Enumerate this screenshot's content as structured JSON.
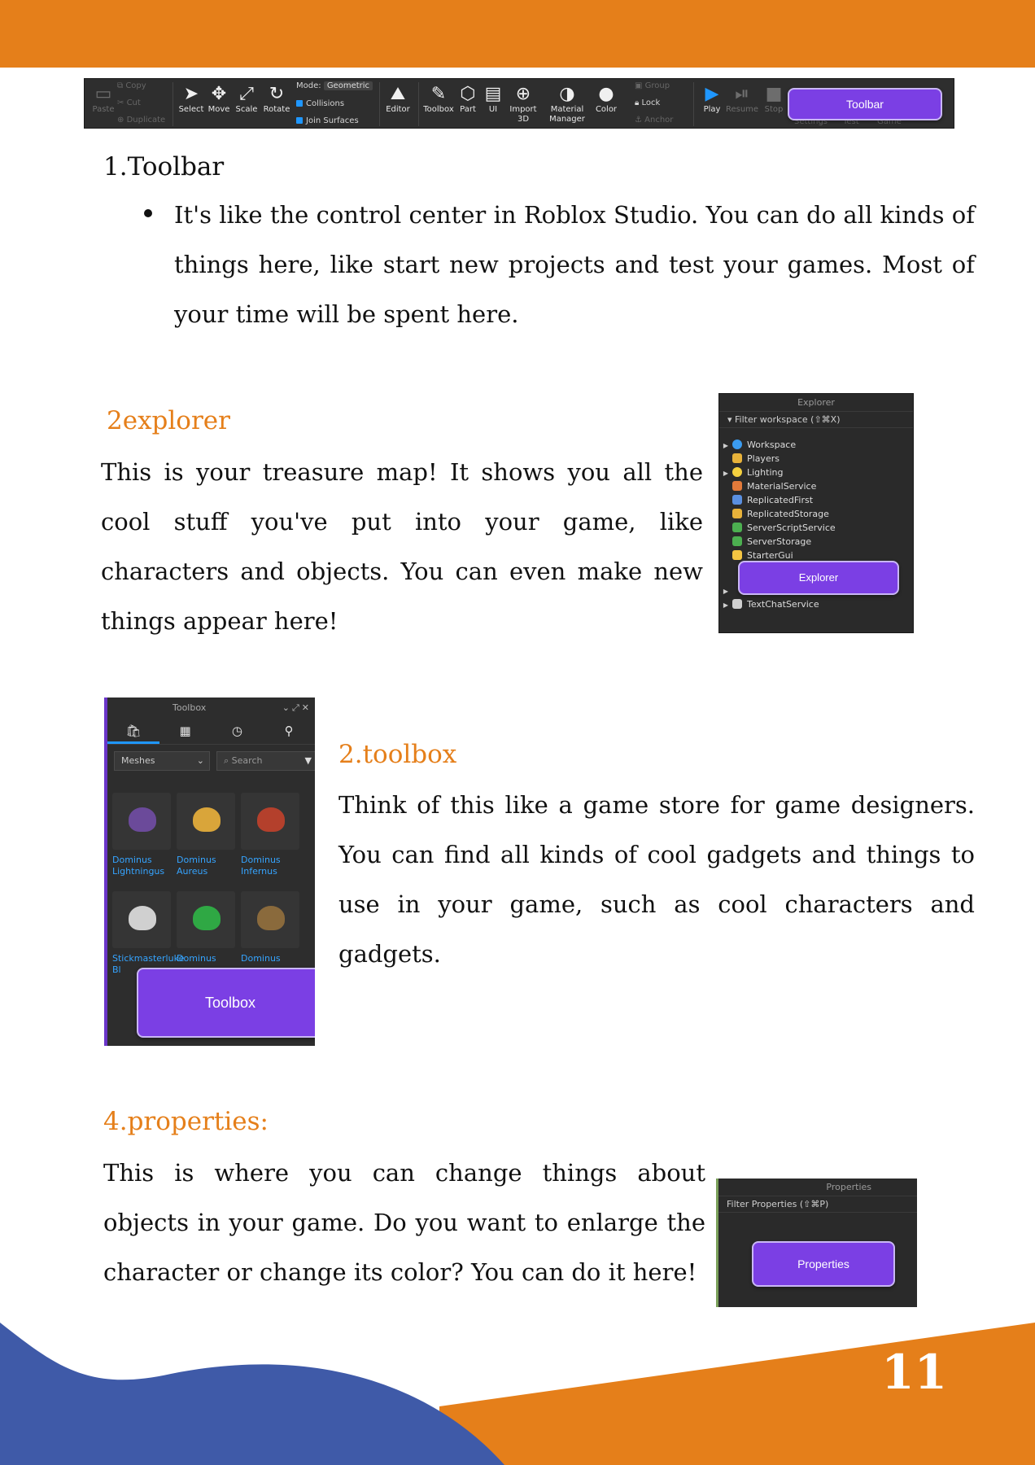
{
  "toolbar_shot": {
    "clipboard": [
      "Paste",
      "Copy",
      "Cut",
      "Duplicate"
    ],
    "tools": [
      "Select",
      "Move",
      "Scale",
      "Rotate"
    ],
    "mode_label": "Mode:",
    "mode_value": "Geometric",
    "collisions": "Collisions",
    "join_surfaces": "Join Surfaces",
    "editor": "Editor",
    "insert": [
      "Toolbox",
      "Part",
      "UI",
      "Import 3D"
    ],
    "material_manager": "Material Manager",
    "color": "Color",
    "group": "Group",
    "lock": "Lock",
    "anchor": "Anchor",
    "play": [
      "Play",
      "Resume",
      "Stop"
    ],
    "right_tabs": [
      "Settings",
      "Test",
      "Game"
    ],
    "callout": "Toolbar"
  },
  "section1": {
    "heading": "1.Toolbar",
    "bullet": "It's like the control center in Roblox Studio. You can do all kinds of things here, like start new projects and test your games. Most of your time will be spent here."
  },
  "section2": {
    "heading": "2explorer",
    "body": "This is your treasure map! It shows you all the cool stuff you've put into your game, like characters and objects. You can even make new things appear here!"
  },
  "explorer_shot": {
    "title": "Explorer",
    "filter": "Filter workspace (⇧⌘X)",
    "items": [
      "Workspace",
      "Players",
      "Lighting",
      "MaterialService",
      "ReplicatedFirst",
      "ReplicatedStorage",
      "ServerScriptService",
      "ServerStorage",
      "StarterGui",
      "TextChatService"
    ],
    "icon_colors": [
      "#3b9cf0",
      "#e8b23a",
      "#f4d03f",
      "#e27a3a",
      "#5a8fe0",
      "#e8b23a",
      "#4caf50",
      "#4caf50",
      "#f4c542",
      "#cfcfcf"
    ],
    "callout": "Explorer"
  },
  "section3": {
    "heading": "2.toolbox",
    "body": "Think of this like a game store for game designers. You can find all kinds of cool gadgets and things to use in your game, such as cool characters and gadgets."
  },
  "toolbox_shot": {
    "title": "Toolbox",
    "category": "Meshes",
    "search_placeholder": "Search",
    "items": [
      "Dominus Lightningus",
      "Dominus Aureus",
      "Dominus Infernus",
      "Stickmasterluke Bl",
      "Dominus",
      "Dominus"
    ],
    "helm_colors": [
      "#6b4a9a",
      "#d9a53a",
      "#b4402c",
      "#d0d0d0",
      "#2fa844",
      "#8a6a3c"
    ],
    "callout": "Toolbox"
  },
  "section4": {
    "heading": "4.properties:",
    "body": "This is where you can change things about objects in your game. Do you want to enlarge the character or change its color? You can do it here!"
  },
  "properties_shot": {
    "title": "Properties",
    "filter": "Filter Properties (⇧⌘P)",
    "callout": "Properties"
  },
  "page_number": "11",
  "colors": {
    "orange": "#e57f1a",
    "blue": "#3f5aa8",
    "purple": "#7b3fe4"
  }
}
